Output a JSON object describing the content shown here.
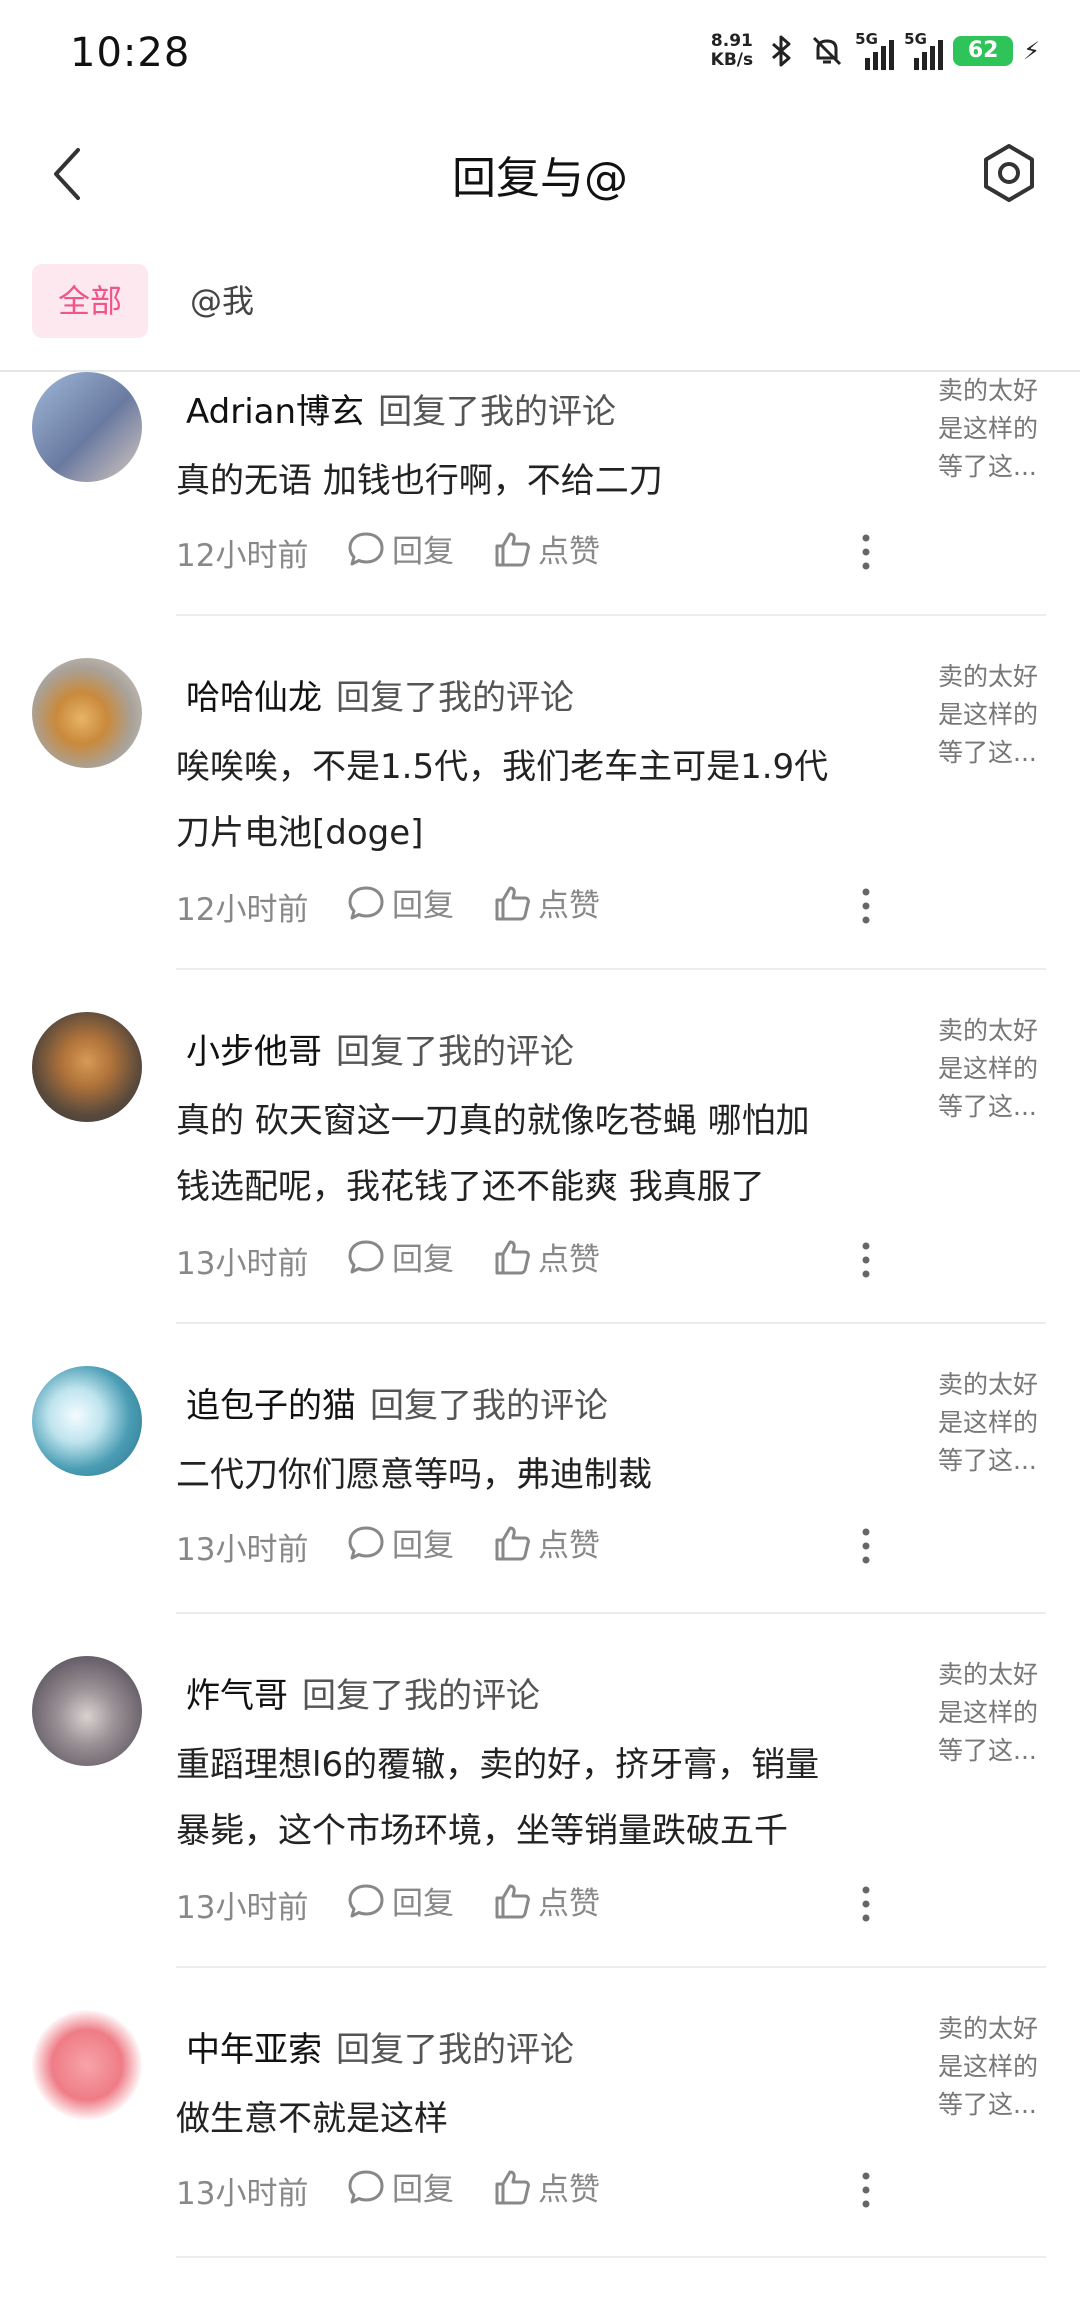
{
  "status_bar": {
    "time": "10:28",
    "net_speed_value": "8.91",
    "net_speed_unit": "KB/s",
    "signal1_label": "5G",
    "signal2_label": "5G",
    "battery_level": "62"
  },
  "header": {
    "title": "回复与@"
  },
  "tabs": [
    {
      "label": "全部",
      "active": true
    },
    {
      "label": "@我",
      "active": false
    }
  ],
  "items": [
    {
      "user": "Adrian博玄",
      "action": "回复了我的评论",
      "content": [
        "真的无语  加钱也行啊，不给二刀"
      ],
      "time": "12小时前",
      "reply_label": "回复",
      "like_label": "点赞",
      "snippet": [
        "卖的太好",
        "是这样的",
        "等了这..."
      ]
    },
    {
      "user": "哈哈仙龙",
      "action": "回复了我的评论",
      "content": [
        "唉唉唉，不是1.5代，我们老车主可是1.9代",
        "刀片电池[doge]"
      ],
      "time": "12小时前",
      "reply_label": "回复",
      "like_label": "点赞",
      "snippet": [
        "卖的太好",
        "是这样的",
        "等了这..."
      ]
    },
    {
      "user": "小步他哥",
      "action": "回复了我的评论",
      "content": [
        "真的 砍天窗这一刀真的就像吃苍蝇  哪怕加",
        "钱选配呢，我花钱了还不能爽 我真服了"
      ],
      "time": "13小时前",
      "reply_label": "回复",
      "like_label": "点赞",
      "snippet": [
        "卖的太好",
        "是这样的",
        "等了这..."
      ]
    },
    {
      "user": "追包子的猫",
      "action": "回复了我的评论",
      "content": [
        "二代刀你们愿意等吗，弗迪制裁"
      ],
      "time": "13小时前",
      "reply_label": "回复",
      "like_label": "点赞",
      "snippet": [
        "卖的太好",
        "是这样的",
        "等了这..."
      ]
    },
    {
      "user": "炸气哥",
      "action": "回复了我的评论",
      "content": [
        "重蹈理想l6的覆辙，卖的好，挤牙膏，销量",
        "暴毙，这个市场环境，坐等销量跌破五千"
      ],
      "time": "13小时前",
      "reply_label": "回复",
      "like_label": "点赞",
      "snippet": [
        "卖的太好",
        "是这样的",
        "等了这..."
      ]
    },
    {
      "user": "中年亚索",
      "action": "回复了我的评论",
      "content": [
        "做生意不就是这样"
      ],
      "time": "13小时前",
      "reply_label": "回复",
      "like_label": "点赞",
      "snippet": [
        "卖的太好",
        "是这样的",
        "等了这..."
      ]
    }
  ],
  "colors": {
    "accent": "#f0548a",
    "tab_bg": "#fde8ef",
    "battery": "#2ec45a"
  }
}
